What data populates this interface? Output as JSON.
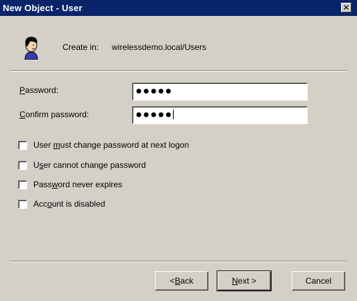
{
  "window": {
    "title": "New Object - User",
    "close_glyph": "✕"
  },
  "header": {
    "icon": "user-icon",
    "create_in_label": "Create in:",
    "create_in_path": "wirelessdemo.local/Users"
  },
  "fields": {
    "password": {
      "label_pre": "",
      "label_mn": "P",
      "label_post": "assword:",
      "value": "●●●●●"
    },
    "confirm_password": {
      "label_pre": "",
      "label_mn": "C",
      "label_post": "onfirm password:",
      "value": "●●●●●"
    }
  },
  "options": [
    {
      "pre": "User ",
      "mn": "m",
      "post": "ust change password at next logon",
      "checked": false
    },
    {
      "pre": "U",
      "mn": "s",
      "post": "er cannot change password",
      "checked": false
    },
    {
      "pre": "Pass",
      "mn": "w",
      "post": "ord never expires",
      "checked": false
    },
    {
      "pre": "Acc",
      "mn": "o",
      "post": "unt is disabled",
      "checked": false
    }
  ],
  "buttons": {
    "back": {
      "pre": "< ",
      "mn": "B",
      "post": "ack"
    },
    "next": {
      "pre": "",
      "mn": "N",
      "post": "ext >"
    },
    "cancel": {
      "label": "Cancel"
    }
  }
}
